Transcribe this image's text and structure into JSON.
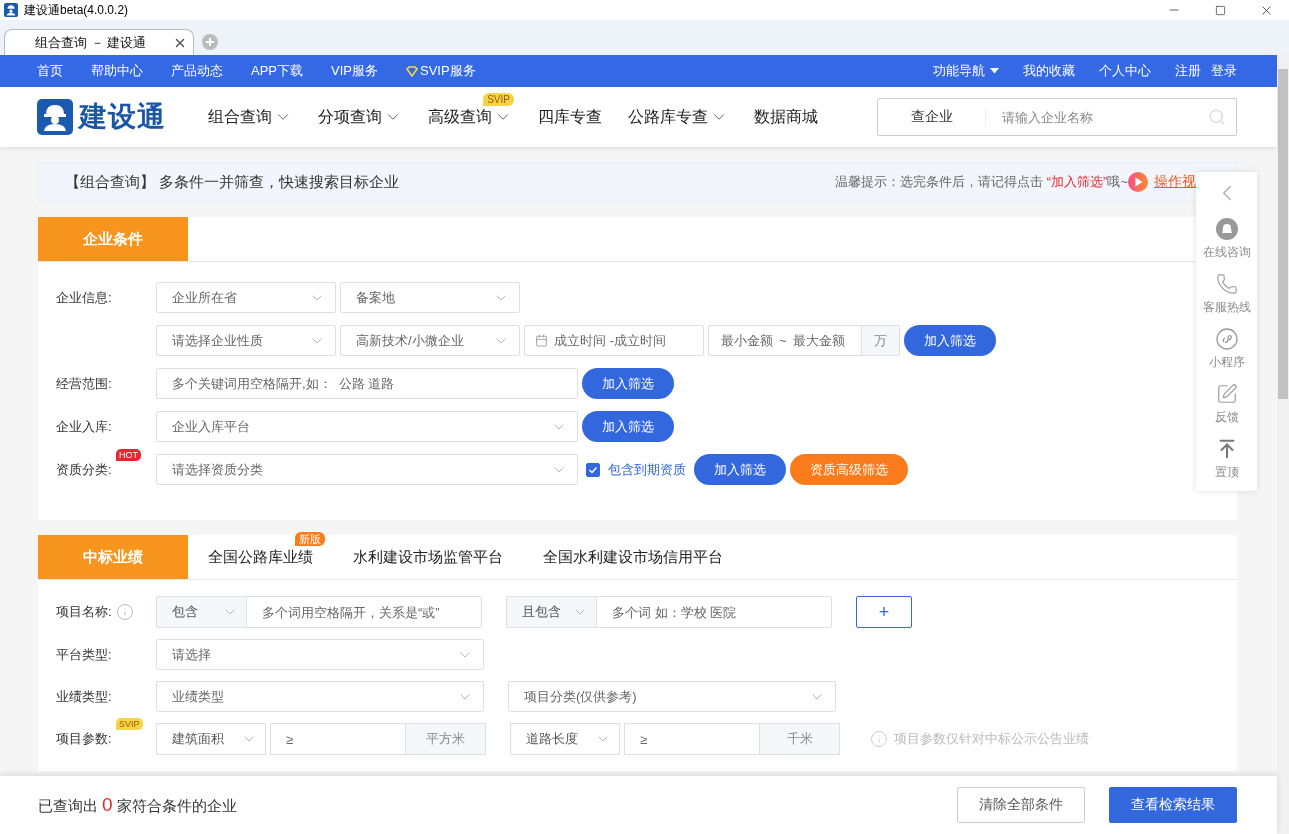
{
  "window": {
    "title": "建设通beta(4.0.0.2)"
  },
  "browser_tabs": [
    {
      "label": "组合查询 － 建设通",
      "selected": true
    }
  ],
  "top_nav": {
    "left": [
      {
        "label": "首页",
        "kind": "link"
      },
      {
        "label": "帮助中心",
        "kind": "link"
      },
      {
        "label": "产品动态",
        "kind": "link"
      },
      {
        "label": "APP下载",
        "kind": "link"
      },
      {
        "label": "VIP服务",
        "kind": "link"
      },
      {
        "label": "SVIP服务",
        "kind": "svip"
      }
    ],
    "right": [
      {
        "label": "功能导航",
        "kind": "dropdown"
      },
      {
        "label": "我的收藏",
        "kind": "link"
      },
      {
        "label": "个人中心",
        "kind": "link"
      },
      {
        "label": "注册",
        "kind": "link"
      },
      {
        "label": "登录",
        "kind": "link"
      }
    ]
  },
  "header": {
    "logo": "建设通",
    "nav": [
      {
        "label": "组合查询",
        "dropdown": true
      },
      {
        "label": "分项查询",
        "dropdown": true
      },
      {
        "label": "高级查询",
        "dropdown": true,
        "badge": "SVIP"
      },
      {
        "label": "四库专查",
        "dropdown": false
      },
      {
        "label": "公路库专查",
        "dropdown": true
      },
      {
        "label": "数据商城",
        "dropdown": false
      }
    ],
    "search": {
      "type": "查企业",
      "placeholder": "请输入企业名称"
    }
  },
  "notice": {
    "title": "【组合查询】 多条件一并筛查，快速搜索目标企业",
    "tip": "温馨提示：选完条件后，请记得点击",
    "highlight": "“加入筛选”",
    "tail": "哦~",
    "video_link": "操作视"
  },
  "sections": [
    {
      "tabs": [
        {
          "label": "企业条件",
          "selected": true
        }
      ],
      "rows": [
        {
          "label": "企业信息:",
          "controls": [
            {
              "kind": "select",
              "placeholder": "企业所在省"
            },
            {
              "kind": "select",
              "placeholder": "备案地"
            }
          ]
        },
        {
          "controls": [
            {
              "kind": "select",
              "placeholder": "请选择企业性质"
            },
            {
              "kind": "select",
              "placeholder": "高新技术/小微企业"
            },
            {
              "kind": "date_range",
              "start": "成立时间",
              "end": "-成立时间"
            },
            {
              "kind": "amount_range",
              "min": "最小金额",
              "sep": "~",
              "max": "最大金额",
              "unit": "万"
            },
            {
              "kind": "button",
              "label": "加入筛选"
            }
          ]
        },
        {
          "label": "经营范围:",
          "controls": [
            {
              "kind": "input",
              "placeholder": "多个关键词用空格隔开,如：  公路 道路"
            },
            {
              "kind": "button",
              "label": "加入筛选"
            }
          ]
        },
        {
          "label": "企业入库:",
          "controls": [
            {
              "kind": "select",
              "placeholder": "企业入库平台"
            },
            {
              "kind": "button",
              "label": "加入筛选"
            }
          ]
        },
        {
          "label": "资质分类:",
          "badge": "HOT",
          "controls": [
            {
              "kind": "select",
              "placeholder": "请选择资质分类"
            },
            {
              "kind": "checkbox",
              "label": "包含到期资质",
              "checked": true
            },
            {
              "kind": "button",
              "label": "加入筛选"
            },
            {
              "kind": "accent",
              "label": "资质高级筛选"
            }
          ]
        }
      ]
    },
    {
      "tabs": [
        {
          "label": "中标业绩",
          "selected": true
        },
        {
          "label": "全国公路库业绩",
          "selected": false,
          "badge": "新版"
        },
        {
          "label": "水利建设市场监管平台",
          "selected": false
        },
        {
          "label": "全国水利建设市场信用平台",
          "selected": false
        }
      ],
      "rows": [
        {
          "label": "项目名称:",
          "info": true,
          "controls": [
            {
              "kind": "combo",
              "prefix": "包含",
              "placeholder": "多个词用空格隔开，关系是“或”"
            },
            {
              "kind": "combo",
              "prefix": "且包含",
              "placeholder": "多个词 如：学校 医院"
            },
            {
              "kind": "add_button",
              "label": "+"
            }
          ]
        },
        {
          "label": "平台类型:",
          "controls": [
            {
              "kind": "select",
              "placeholder": "请选择"
            }
          ]
        },
        {
          "label": "业绩类型:",
          "controls": [
            {
              "kind": "select",
              "placeholder": "业绩类型"
            },
            {
              "kind": "select",
              "placeholder": "项目分类(仅供参考)"
            }
          ]
        },
        {
          "label": "项目参数:",
          "badge": "SVIP",
          "controls": [
            {
              "kind": "unit_combo",
              "prefix": "建筑面积",
              "placeholder": "≥",
              "unit": "平方米"
            },
            {
              "kind": "unit_combo",
              "prefix": "道路长度",
              "placeholder": "≥",
              "unit": "千米"
            },
            {
              "kind": "note",
              "text": "项目参数仅针对中标公示公告业绩"
            }
          ]
        }
      ]
    }
  ],
  "side_panel": [
    {
      "label": "在线咨询"
    },
    {
      "label": "客服热线"
    },
    {
      "label": "小程序"
    },
    {
      "label": "反馈"
    },
    {
      "label": "置顶"
    }
  ],
  "footer": {
    "prefix": "已查询出",
    "count": "0",
    "suffix": "家符合条件的企业",
    "buttons": [
      {
        "label": "清除全部条件"
      },
      {
        "label": "查看检索结果"
      }
    ]
  }
}
